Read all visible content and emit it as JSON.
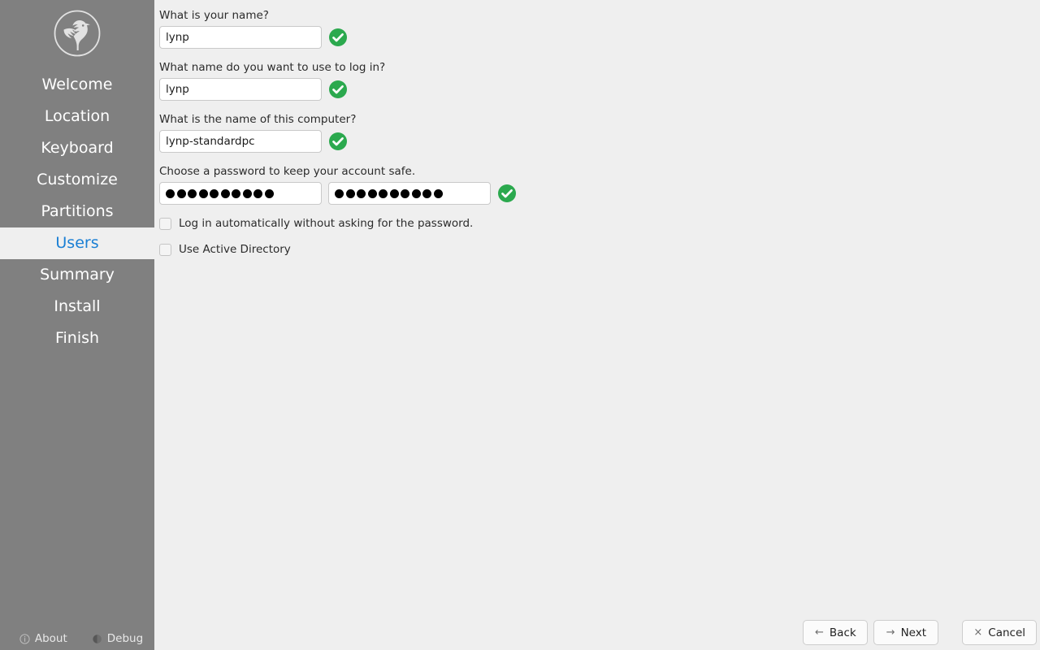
{
  "sidebar": {
    "logo_icon": "bird-logo-icon",
    "items": [
      {
        "label": "Welcome",
        "active": false
      },
      {
        "label": "Location",
        "active": false
      },
      {
        "label": "Keyboard",
        "active": false
      },
      {
        "label": "Customize",
        "active": false
      },
      {
        "label": "Partitions",
        "active": false
      },
      {
        "label": "Users",
        "active": true
      },
      {
        "label": "Summary",
        "active": false
      },
      {
        "label": "Install",
        "active": false
      },
      {
        "label": "Finish",
        "active": false
      }
    ],
    "footer": {
      "about_label": "About",
      "about_icon": "info-circle-icon",
      "debug_label": "Debug",
      "debug_icon": "debug-circle-icon"
    },
    "colors": {
      "background": "#808080",
      "text": "#ffffff",
      "active_background": "#efefef",
      "active_text": "#1a7fd4"
    }
  },
  "main": {
    "background": "#efefef",
    "fields": {
      "fullname": {
        "label": "What is your name?",
        "value": "lynp",
        "placeholder": "",
        "valid": true,
        "valid_icon": "green-check-icon"
      },
      "username": {
        "label": "What name do you want to use to log in?",
        "value": "lynp",
        "placeholder": "",
        "valid": true,
        "valid_icon": "green-check-icon"
      },
      "hostname": {
        "label": "What is the name of this computer?",
        "value": "lynp-standardpc",
        "placeholder": "",
        "valid": true,
        "valid_icon": "green-check-icon"
      },
      "password": {
        "label": "Choose a password to keep your account safe.",
        "masked_char_count": 10,
        "confirm_masked_char_count": 10,
        "valid": true,
        "valid_icon": "green-check-icon"
      }
    },
    "checkboxes": [
      {
        "label": "Log in automatically without asking for the password.",
        "checked": false
      },
      {
        "label": "Use Active Directory",
        "checked": false
      }
    ],
    "colors": {
      "label_text": "#2b2b2b",
      "input_background": "#ffffff",
      "input_border": "#c9c9c9",
      "valid_green": "#2ba94e"
    }
  },
  "buttons": {
    "back": {
      "label": "Back",
      "icon": "arrow-left-icon",
      "glyph": "←"
    },
    "next": {
      "label": "Next",
      "icon": "arrow-right-icon",
      "glyph": "→"
    },
    "cancel": {
      "label": "Cancel",
      "icon": "close-x-icon",
      "glyph": "×"
    }
  }
}
